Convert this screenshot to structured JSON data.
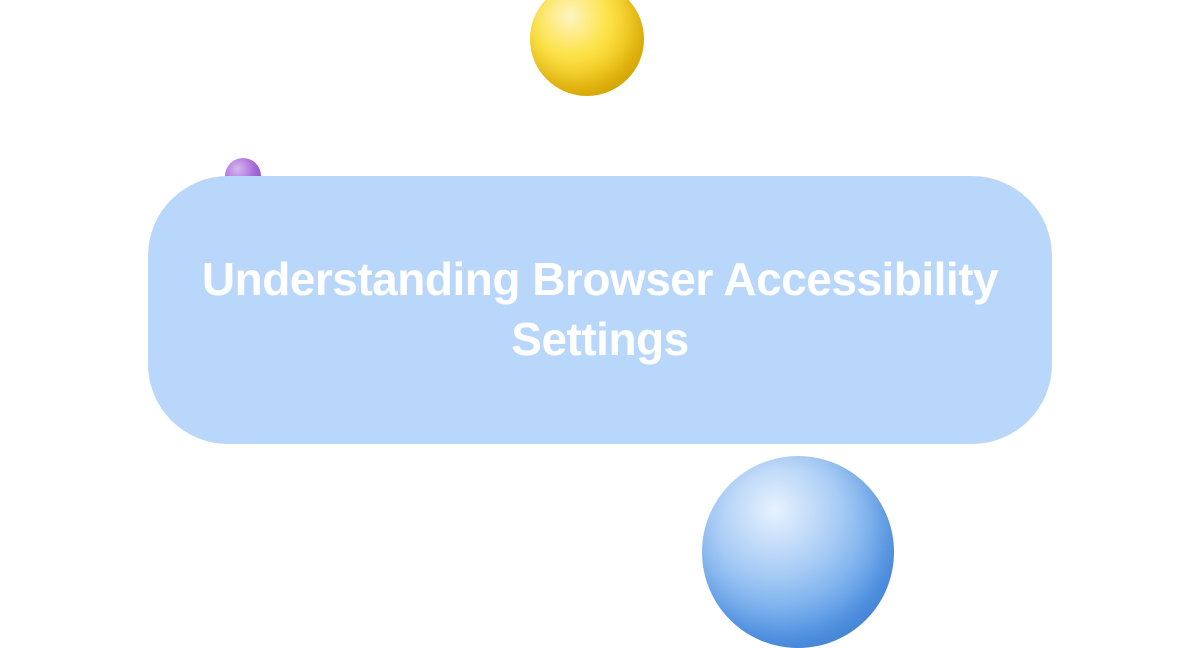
{
  "title": "Understanding Browser Accessibility Settings"
}
